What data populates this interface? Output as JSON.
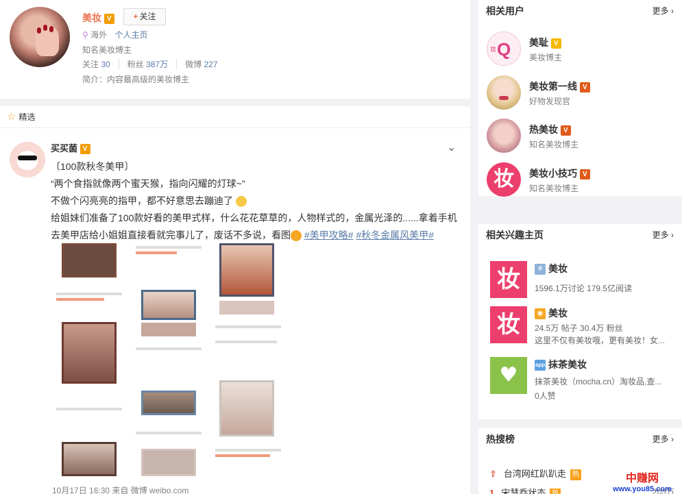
{
  "profile": {
    "name": "美妆",
    "follow_label": "关注",
    "location": "海外",
    "homepage_link": "个人主页",
    "title": "知名美妆博主",
    "stats": [
      {
        "label": "关注",
        "value": "30"
      },
      {
        "label": "粉丝",
        "value": "387万"
      },
      {
        "label": "微博",
        "value": "227"
      }
    ],
    "bio": "简介：内容最高级的美妆博主"
  },
  "feed": {
    "header": "精选",
    "post": {
      "author": "买买菌",
      "lines": [
        "〔100款秋冬美甲〕",
        "“两个食指就像两个蜜天猴，指向闪耀的灯球~”",
        "不做个闪亮亮的指甲，都不好意思去蹦迪了",
        "给姐妹们准备了100款好看的美甲式样，什么花花草草的，人物样式的，金属光泽的......拿着手机",
        "去美甲店给小姐姐直接看就完事儿了，废话不多说，看图"
      ],
      "tags": [
        "#美甲攻略#",
        "#秋冬金属风美甲#"
      ],
      "footer": "10月17日 16:30 来自 微博 weibo.com"
    }
  },
  "related_users": {
    "title": "相关用户",
    "more": "更多",
    "items": [
      {
        "name": "美耻",
        "desc": "美妆博主"
      },
      {
        "name": "美妆第一线",
        "desc": "好物发现官"
      },
      {
        "name": "热美妆",
        "desc": "知名美妆博主"
      },
      {
        "name": "美妆小技巧",
        "desc": "知名美妆博主"
      }
    ]
  },
  "related_interest": {
    "title": "相关兴趣主页",
    "more": "更多",
    "items": [
      {
        "glyph": "妆",
        "title": "美妆",
        "lines": [
          "1596.1万讨论 179.5亿阅读"
        ]
      },
      {
        "glyph": "妆",
        "title": "美妆",
        "lines": [
          "24.5万 帖子 30.4万 粉丝",
          "这里不仅有美妆哦，更有美妆！女..."
        ]
      },
      {
        "glyph": "♥",
        "title": "抹茶美妆",
        "lines": [
          "抹茶美妆（mocha.cn）淘妆品,查...",
          "0人赞"
        ]
      }
    ]
  },
  "hot_search": {
    "title": "热搜榜",
    "more": "更多",
    "items": [
      {
        "rank": "⇧",
        "text": "台湾网红趴趴走",
        "badge": "热",
        "count": ""
      },
      {
        "rank": "1",
        "text": "宋慧乔状态",
        "badge": "热",
        "count": "203万"
      }
    ]
  },
  "watermark": {
    "line1": "中赚网",
    "line2": "www.you85.com"
  },
  "colors": {
    "accent": "#eb7350",
    "link": "#5a7ca8",
    "vip": "#f39c00",
    "pink_tile": "#f0436f",
    "green_tile": "#8bc34a"
  }
}
